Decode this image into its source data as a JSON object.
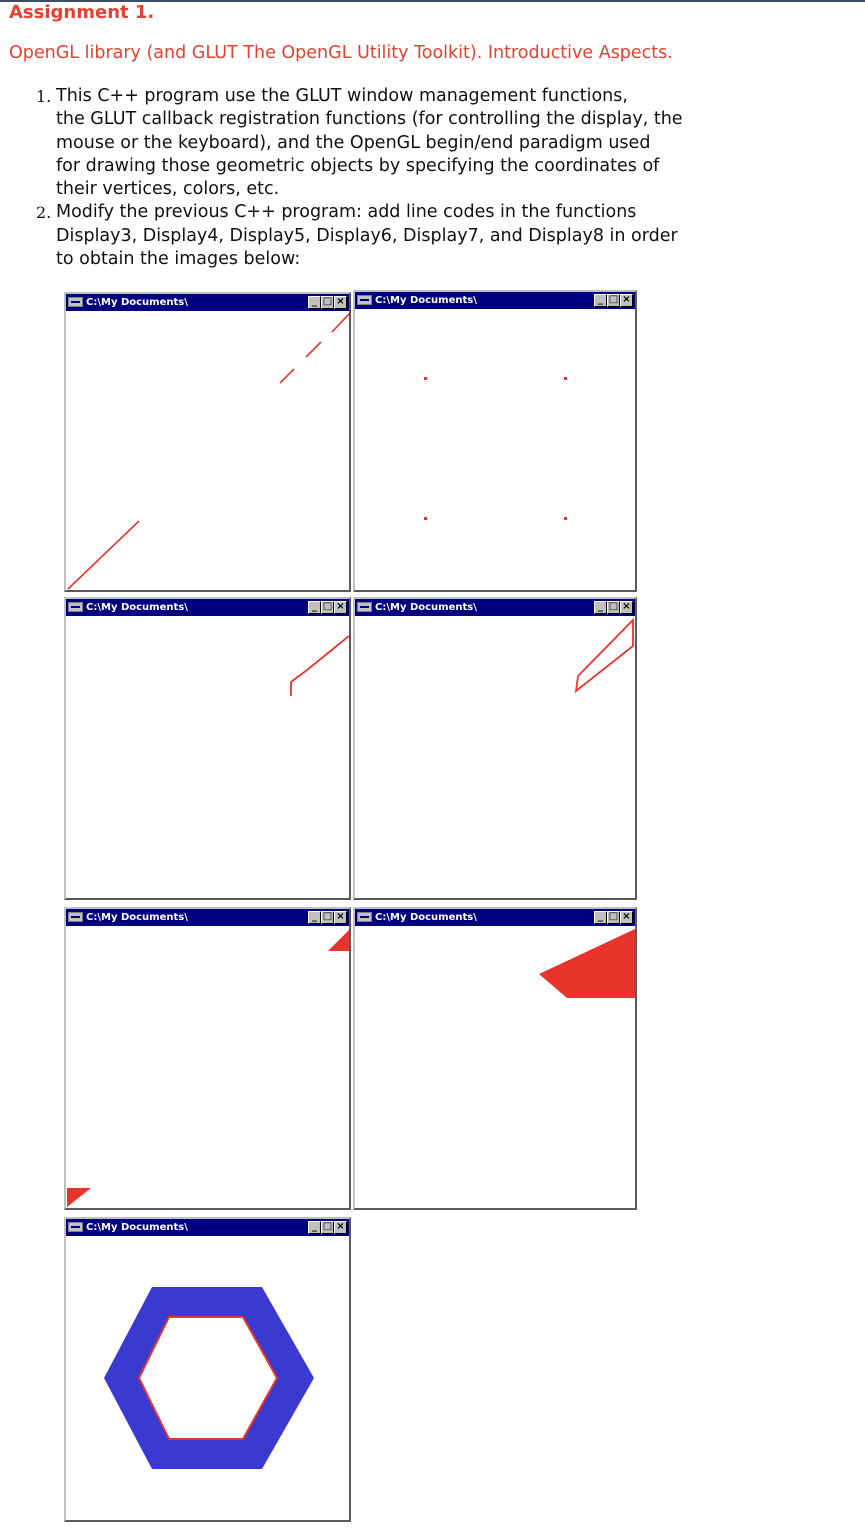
{
  "heading": "Assignment 1.",
  "subtitle": "OpenGL library (and GLUT The OpenGL Utility Toolkit). Introductive Aspects.",
  "items": [
    {
      "num": "1.",
      "lines": [
        "This C++ program use the GLUT window management functions,",
        "the GLUT callback registration functions (for controlling the display, the",
        "mouse or the keyboard), and the OpenGL begin/end paradigm used",
        "for drawing those geometric objects by specifying the coordinates of",
        "their vertices, colors, etc."
      ]
    },
    {
      "num": "2.",
      "lines": [
        "Modify the previous C++ program: add line codes in the functions",
        "Display3, Display4, Display5, Display6, Display7, and Display8 in order",
        "to obtain the images below:"
      ]
    }
  ],
  "window_title": "C:\\My Documents\\",
  "window_buttons": {
    "minimize": "_",
    "maximize": "□",
    "close": "×"
  },
  "colors": {
    "drawing_red": "#e8342c",
    "fill_blue": "#3a3ad0",
    "titlebar": "#000080"
  }
}
